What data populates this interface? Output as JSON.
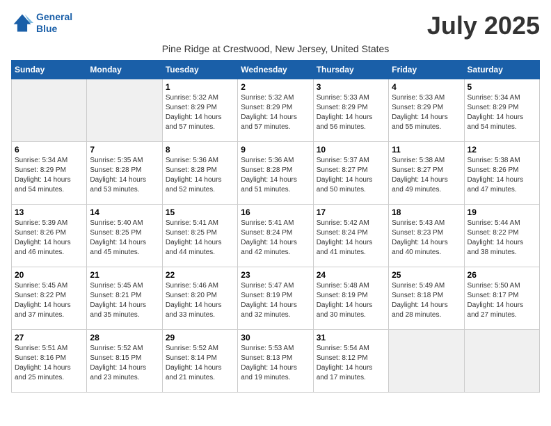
{
  "logo": {
    "line1": "General",
    "line2": "Blue"
  },
  "title": "July 2025",
  "subtitle": "Pine Ridge at Crestwood, New Jersey, United States",
  "weekdays": [
    "Sunday",
    "Monday",
    "Tuesday",
    "Wednesday",
    "Thursday",
    "Friday",
    "Saturday"
  ],
  "weeks": [
    [
      {
        "day": "",
        "info": ""
      },
      {
        "day": "",
        "info": ""
      },
      {
        "day": "1",
        "info": "Sunrise: 5:32 AM\nSunset: 8:29 PM\nDaylight: 14 hours and 57 minutes."
      },
      {
        "day": "2",
        "info": "Sunrise: 5:32 AM\nSunset: 8:29 PM\nDaylight: 14 hours and 57 minutes."
      },
      {
        "day": "3",
        "info": "Sunrise: 5:33 AM\nSunset: 8:29 PM\nDaylight: 14 hours and 56 minutes."
      },
      {
        "day": "4",
        "info": "Sunrise: 5:33 AM\nSunset: 8:29 PM\nDaylight: 14 hours and 55 minutes."
      },
      {
        "day": "5",
        "info": "Sunrise: 5:34 AM\nSunset: 8:29 PM\nDaylight: 14 hours and 54 minutes."
      }
    ],
    [
      {
        "day": "6",
        "info": "Sunrise: 5:34 AM\nSunset: 8:29 PM\nDaylight: 14 hours and 54 minutes."
      },
      {
        "day": "7",
        "info": "Sunrise: 5:35 AM\nSunset: 8:28 PM\nDaylight: 14 hours and 53 minutes."
      },
      {
        "day": "8",
        "info": "Sunrise: 5:36 AM\nSunset: 8:28 PM\nDaylight: 14 hours and 52 minutes."
      },
      {
        "day": "9",
        "info": "Sunrise: 5:36 AM\nSunset: 8:28 PM\nDaylight: 14 hours and 51 minutes."
      },
      {
        "day": "10",
        "info": "Sunrise: 5:37 AM\nSunset: 8:27 PM\nDaylight: 14 hours and 50 minutes."
      },
      {
        "day": "11",
        "info": "Sunrise: 5:38 AM\nSunset: 8:27 PM\nDaylight: 14 hours and 49 minutes."
      },
      {
        "day": "12",
        "info": "Sunrise: 5:38 AM\nSunset: 8:26 PM\nDaylight: 14 hours and 47 minutes."
      }
    ],
    [
      {
        "day": "13",
        "info": "Sunrise: 5:39 AM\nSunset: 8:26 PM\nDaylight: 14 hours and 46 minutes."
      },
      {
        "day": "14",
        "info": "Sunrise: 5:40 AM\nSunset: 8:25 PM\nDaylight: 14 hours and 45 minutes."
      },
      {
        "day": "15",
        "info": "Sunrise: 5:41 AM\nSunset: 8:25 PM\nDaylight: 14 hours and 44 minutes."
      },
      {
        "day": "16",
        "info": "Sunrise: 5:41 AM\nSunset: 8:24 PM\nDaylight: 14 hours and 42 minutes."
      },
      {
        "day": "17",
        "info": "Sunrise: 5:42 AM\nSunset: 8:24 PM\nDaylight: 14 hours and 41 minutes."
      },
      {
        "day": "18",
        "info": "Sunrise: 5:43 AM\nSunset: 8:23 PM\nDaylight: 14 hours and 40 minutes."
      },
      {
        "day": "19",
        "info": "Sunrise: 5:44 AM\nSunset: 8:22 PM\nDaylight: 14 hours and 38 minutes."
      }
    ],
    [
      {
        "day": "20",
        "info": "Sunrise: 5:45 AM\nSunset: 8:22 PM\nDaylight: 14 hours and 37 minutes."
      },
      {
        "day": "21",
        "info": "Sunrise: 5:45 AM\nSunset: 8:21 PM\nDaylight: 14 hours and 35 minutes."
      },
      {
        "day": "22",
        "info": "Sunrise: 5:46 AM\nSunset: 8:20 PM\nDaylight: 14 hours and 33 minutes."
      },
      {
        "day": "23",
        "info": "Sunrise: 5:47 AM\nSunset: 8:19 PM\nDaylight: 14 hours and 32 minutes."
      },
      {
        "day": "24",
        "info": "Sunrise: 5:48 AM\nSunset: 8:19 PM\nDaylight: 14 hours and 30 minutes."
      },
      {
        "day": "25",
        "info": "Sunrise: 5:49 AM\nSunset: 8:18 PM\nDaylight: 14 hours and 28 minutes."
      },
      {
        "day": "26",
        "info": "Sunrise: 5:50 AM\nSunset: 8:17 PM\nDaylight: 14 hours and 27 minutes."
      }
    ],
    [
      {
        "day": "27",
        "info": "Sunrise: 5:51 AM\nSunset: 8:16 PM\nDaylight: 14 hours and 25 minutes."
      },
      {
        "day": "28",
        "info": "Sunrise: 5:52 AM\nSunset: 8:15 PM\nDaylight: 14 hours and 23 minutes."
      },
      {
        "day": "29",
        "info": "Sunrise: 5:52 AM\nSunset: 8:14 PM\nDaylight: 14 hours and 21 minutes."
      },
      {
        "day": "30",
        "info": "Sunrise: 5:53 AM\nSunset: 8:13 PM\nDaylight: 14 hours and 19 minutes."
      },
      {
        "day": "31",
        "info": "Sunrise: 5:54 AM\nSunset: 8:12 PM\nDaylight: 14 hours and 17 minutes."
      },
      {
        "day": "",
        "info": ""
      },
      {
        "day": "",
        "info": ""
      }
    ]
  ]
}
